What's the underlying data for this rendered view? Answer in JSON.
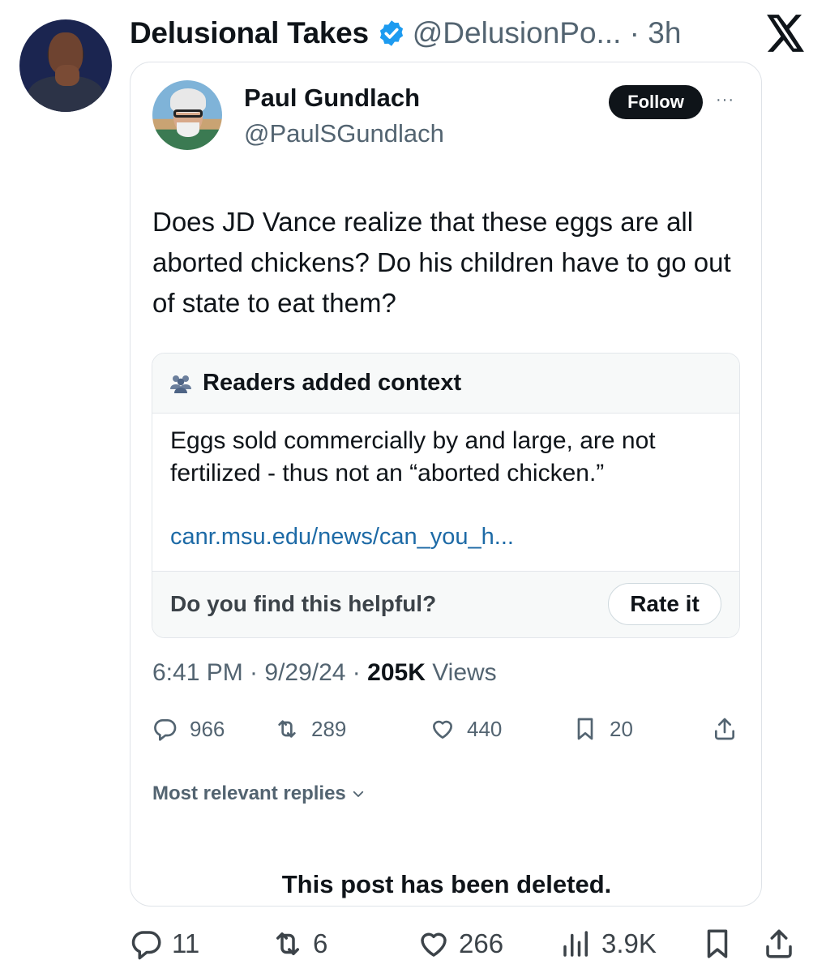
{
  "outer_post": {
    "display_name": "Delusional Takes",
    "handle_time": "@DelusionPo... · 3h",
    "actions": {
      "replies": "11",
      "reposts": "6",
      "likes": "266",
      "views": "3.9K"
    }
  },
  "quoted_post": {
    "display_name": "Paul Gundlach",
    "handle": "@PaulSGundlach",
    "follow_label": "Follow",
    "more_label": "···",
    "text": "Does JD Vance realize that these eggs are all aborted chickens? Do his children have to go out of state to eat them?",
    "note": {
      "title": "Readers added context",
      "body": "Eggs sold commercially by and large, are not fertilized - thus not an “aborted chicken.”",
      "link": "canr.msu.edu/news/can_you_h...",
      "helpful_question": "Do you find this helpful?",
      "rate_label": "Rate it"
    },
    "timestamp": "6:41 PM · 9/29/24 · ",
    "views_count": "205K",
    "views_label": " Views",
    "actions": {
      "replies": "966",
      "reposts": "289",
      "likes": "440",
      "bookmarks": "20"
    },
    "replies_sort_label": "Most relevant replies",
    "deleted_notice": "This post has been deleted."
  },
  "colors": {
    "text": "#0f1419",
    "secondary": "#536471",
    "verified": "#1d9bf0",
    "link": "#1d6aa6",
    "border": "#dfe3e8"
  }
}
